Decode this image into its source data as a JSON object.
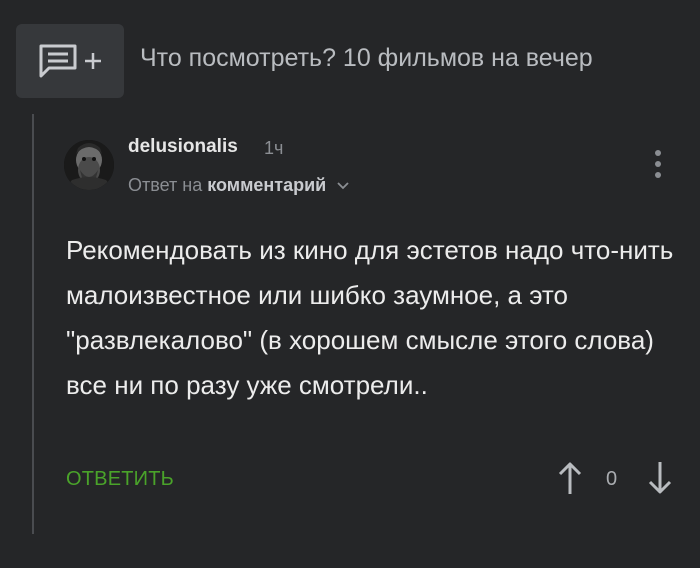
{
  "post": {
    "title": "Что посмотреть? 10 фильмов на вечер"
  },
  "comment": {
    "username": "delusionalis",
    "time": "1ч",
    "reply_prefix": "Ответ на",
    "reply_target": "комментарий",
    "body": "Рекомендовать из кино для эстетов надо что-нить малоизвестное или шибко заумное, а это \"развлекалово\" (в хорошем смысле этого слова) все ни по разу уже смотрели..",
    "reply_label": "ОТВЕТИТЬ",
    "rating": "0"
  },
  "icons": {
    "add_comment": "comment-plus-icon",
    "more": "more-vertical-icon",
    "chevron": "chevron-down-icon",
    "up": "arrow-up-icon",
    "down": "arrow-down-icon"
  },
  "colors": {
    "background": "#252628",
    "accent_green": "#4aa32a",
    "muted_text": "#8b8e93"
  }
}
